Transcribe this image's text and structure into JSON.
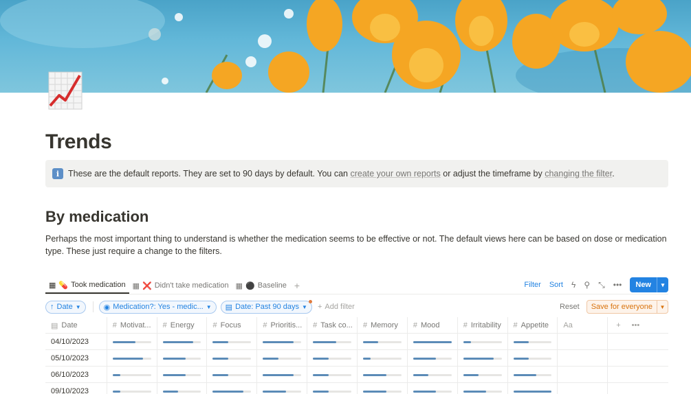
{
  "page": {
    "title": "Trends",
    "icon": "chart-increasing-icon"
  },
  "callout": {
    "icon": "info-icon",
    "icon_glyph": "i",
    "text_before": "These are the default reports. They are set to 90 days by default. You can ",
    "link1": "create your own reports",
    "text_middle": " or adjust the timeframe by ",
    "link2": "changing the filter",
    "text_after": "."
  },
  "section": {
    "heading": "By medication",
    "paragraph": "Perhaps the most important thing to understand is whether the medication seems to be effective or not. The default views here can be based on dose or medication type. These just require a change to the filters."
  },
  "tabs": [
    {
      "label": "Took medication",
      "emoji": "💊",
      "active": true
    },
    {
      "label": "Didn't take medication",
      "emoji": "❌",
      "active": false
    },
    {
      "label": "Baseline",
      "emoji": "⚫",
      "active": false
    }
  ],
  "toolbar": {
    "filter": "Filter",
    "sort": "Sort",
    "new": "New"
  },
  "filters": {
    "sort_pill": "Date",
    "medication_pill": "Medication?: Yes - medic...",
    "date_pill": "Date: Past 90 days",
    "add_filter": "Add filter",
    "reset": "Reset",
    "save": "Save for everyone"
  },
  "columns": [
    "Date",
    "Motivat...",
    "Energy",
    "Focus",
    "Prioritis...",
    "Task co...",
    "Memory",
    "Mood",
    "Irritability",
    "Appetite",
    "Aa"
  ],
  "rows": [
    {
      "date": "04/10/2023",
      "values": [
        0.6,
        0.8,
        0.4,
        0.8,
        0.6,
        0.4,
        1.0,
        0.2,
        0.4
      ]
    },
    {
      "date": "05/10/2023",
      "values": [
        0.8,
        0.6,
        0.4,
        0.4,
        0.4,
        0.2,
        0.6,
        0.8,
        0.4
      ]
    },
    {
      "date": "06/10/2023",
      "values": [
        0.2,
        0.6,
        0.4,
        0.8,
        0.4,
        0.6,
        0.4,
        0.4,
        0.6
      ]
    },
    {
      "date": "09/10/2023",
      "values": [
        0.2,
        0.4,
        0.8,
        0.6,
        0.4,
        0.6,
        0.6,
        0.6,
        1.0
      ]
    }
  ],
  "colors": {
    "accent": "#2383e2",
    "bar_fill": "#5b8bb7",
    "save_orange": "#d9730d"
  }
}
